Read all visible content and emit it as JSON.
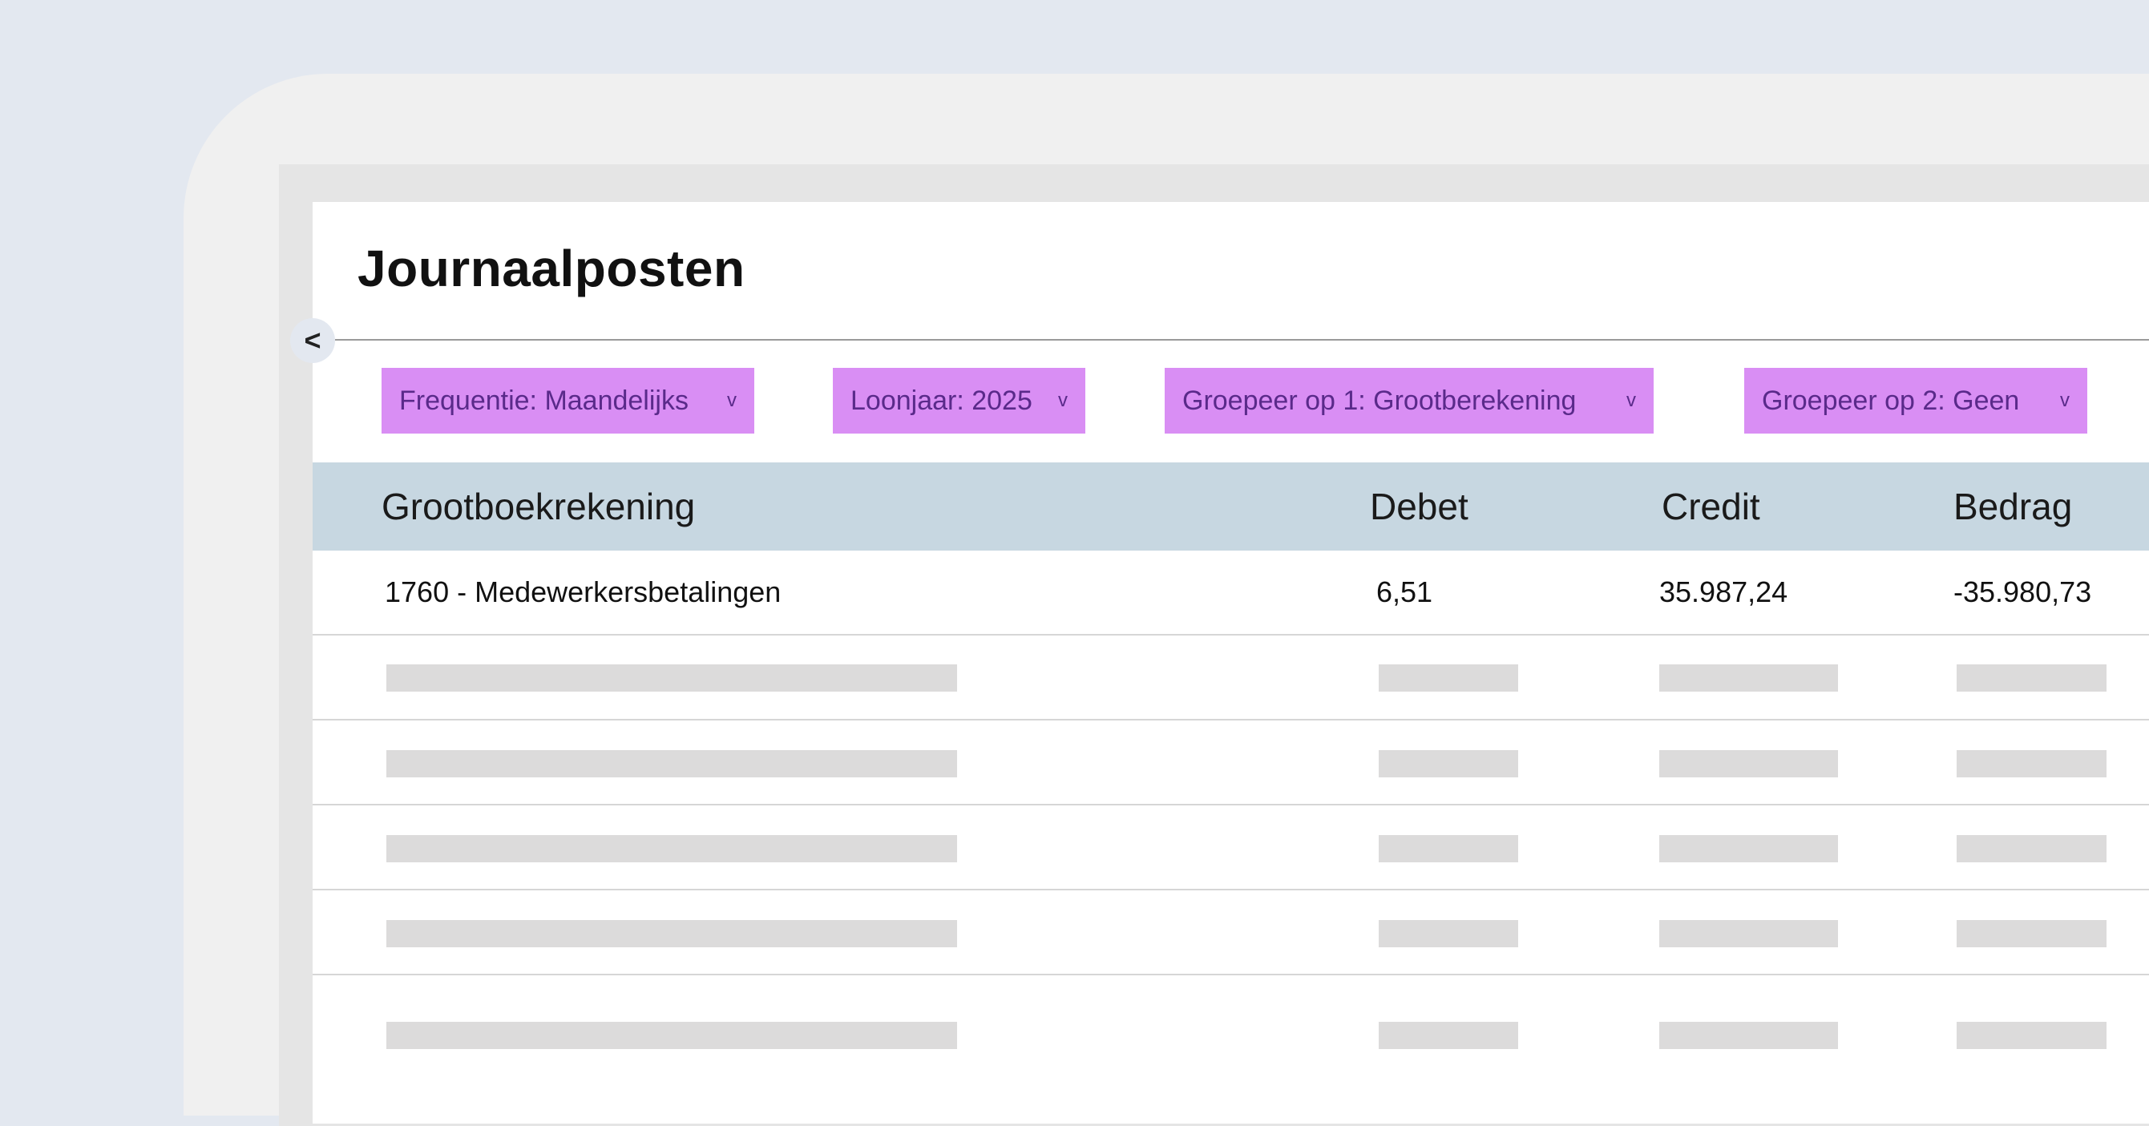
{
  "page": {
    "title": "Journaalposten"
  },
  "collapse_icon": "<",
  "filters": [
    {
      "label": "Frequentie: Maandelijks",
      "chevron": "v"
    },
    {
      "label": "Loonjaar: 2025",
      "chevron": "v"
    },
    {
      "label": "Groepeer op 1: Grootberekening",
      "chevron": "v"
    },
    {
      "label": "Groepeer op 2: Geen",
      "chevron": "v"
    }
  ],
  "table": {
    "columns": [
      "Grootboekrekening",
      "Debet",
      "Credit",
      "Bedrag"
    ],
    "rows": [
      {
        "account": "1760 - Medewerkersbetalingen",
        "debet": "6,51",
        "credit": "35.987,24",
        "bedrag": "-35.980,73"
      }
    ],
    "placeholder_rows": 5
  },
  "colors": {
    "chip_bg": "#d98ef4",
    "chip_text": "#5a2a8a",
    "header_bg": "#c7d7e1",
    "skeleton": "#dcdbdb"
  }
}
